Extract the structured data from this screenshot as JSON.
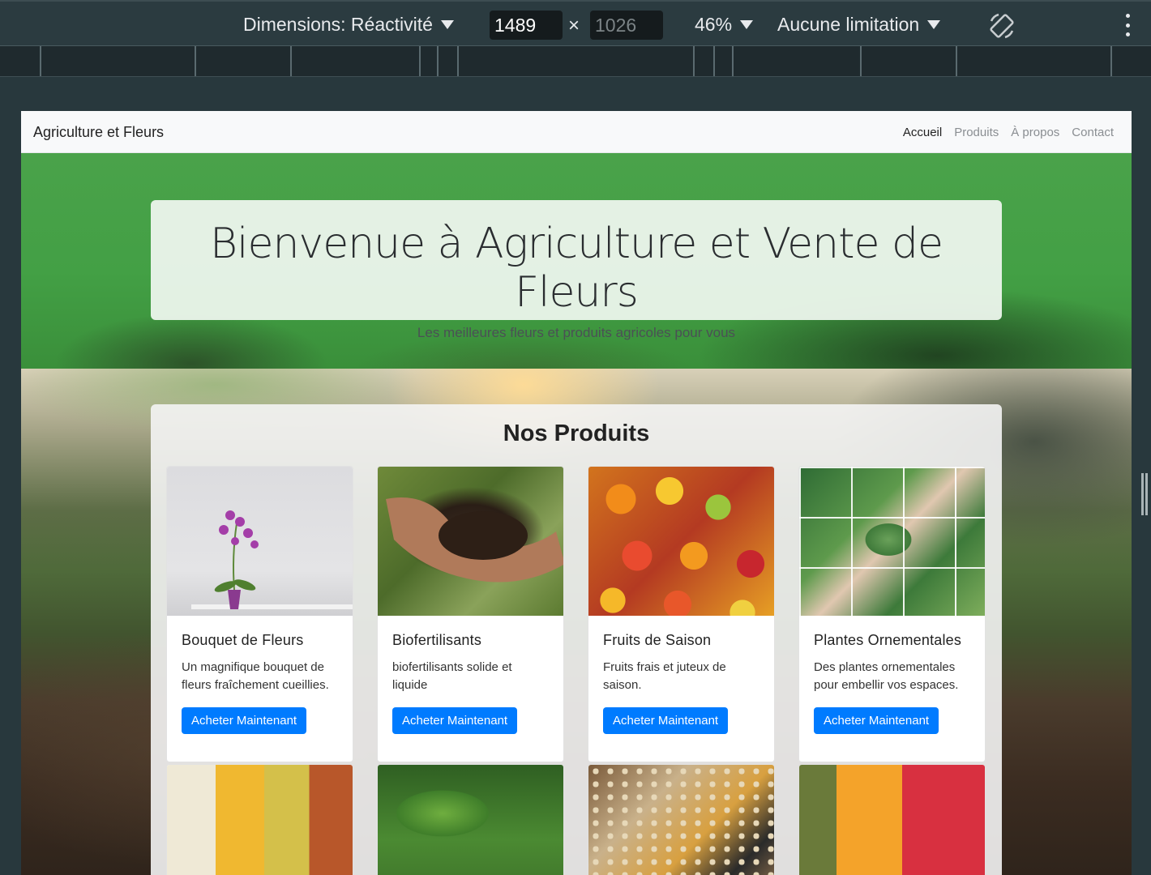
{
  "devtools": {
    "dimensions_label": "Dimensions: Réactivité",
    "width_value": "1489",
    "height_value": "1026",
    "times_symbol": "×",
    "zoom": "46%",
    "throttling": "Aucune limitation",
    "rotate_icon": "rotate-icon",
    "more_icon": "kebab-menu-icon"
  },
  "navbar": {
    "brand": "Agriculture et Fleurs",
    "links": [
      {
        "label": "Accueil",
        "active": true
      },
      {
        "label": "Produits",
        "active": false
      },
      {
        "label": "À propos",
        "active": false
      },
      {
        "label": "Contact",
        "active": false
      }
    ]
  },
  "hero": {
    "title": "Bienvenue à Agriculture et Vente de Fleurs",
    "subtitle": "Les meilleures fleurs et produits agricoles pour vous"
  },
  "products": {
    "title": "Nos Produits",
    "items": [
      {
        "name": "Bouquet de Fleurs",
        "description": "Un magnifique bouquet de fleurs fraîchement cueillies.",
        "button": "Acheter Maintenant"
      },
      {
        "name": "Biofertilisants",
        "description": "biofertilisants solide et liquide",
        "button": "Acheter Maintenant"
      },
      {
        "name": "Fruits de Saison",
        "description": "Fruits frais et juteux de saison.",
        "button": "Acheter Maintenant"
      },
      {
        "name": "Plantes Ornementales",
        "description": "Des plantes ornementales pour embellir vos espaces.",
        "button": "Acheter Maintenant"
      }
    ]
  },
  "colors": {
    "devtools_bg": "#2b3b40",
    "hero_green": "#43a045",
    "button_blue": "#007bff",
    "navbar_bg": "#f8f9fa"
  }
}
